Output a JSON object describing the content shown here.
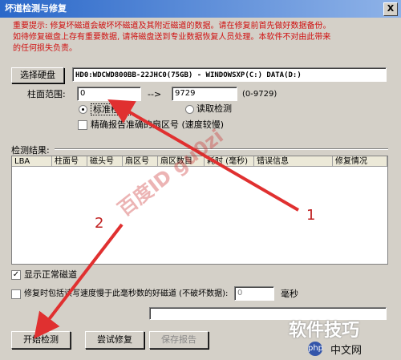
{
  "window": {
    "title": "坏道检测与修复",
    "close_label": "X"
  },
  "warning": {
    "line1": "重要提示: 修复坏磁道会破坏坏磁道及其附近磁道的数据。请在修复前首先做好数据备份。",
    "line2": "如待修复磁盘上存有重要数据, 请将磁盘送到专业数据恢复人员处理。本软件不对由此带来",
    "line3": "的任何损失负责。"
  },
  "disk": {
    "select_label": "选择硬盘",
    "info": "HD0:WDCWD800BB-22JHC0(75GB) - WINDOWSXP(C:) DATA(D:)"
  },
  "range": {
    "label": "柱面范围:",
    "from": "0",
    "arrow": "-->",
    "to": "9729",
    "hint": "(0-9729)"
  },
  "mode": {
    "standard_label": "标准检测",
    "read_label": "读取检测",
    "report_label": "精确报告准确的扇区号 (速度较慢)"
  },
  "results": {
    "label": "检测结果:",
    "columns": [
      "LBA",
      "柱面号",
      "磁头号",
      "扇区号",
      "扇区数目",
      "耗时 (毫秒)",
      "错误信息",
      "修复情况"
    ]
  },
  "options": {
    "show_normal_label": "显示正常磁道",
    "repair_slow_label": "修复时包括读写速度慢于此毫秒数的好磁道 (不破坏数据):",
    "ms_value": "0",
    "ms_unit": "毫秒"
  },
  "buttons": {
    "start": "开始检测",
    "try_repair": "尝试修复",
    "save_report": "保存报告"
  },
  "overlay": {
    "wm1": "百度ID gu0zi",
    "num1": "1",
    "num2": "2",
    "brand1": "软件技巧",
    "brand2": "中文网"
  },
  "colors": {
    "warning_text": "#d01010",
    "arrow": "#e03030"
  }
}
